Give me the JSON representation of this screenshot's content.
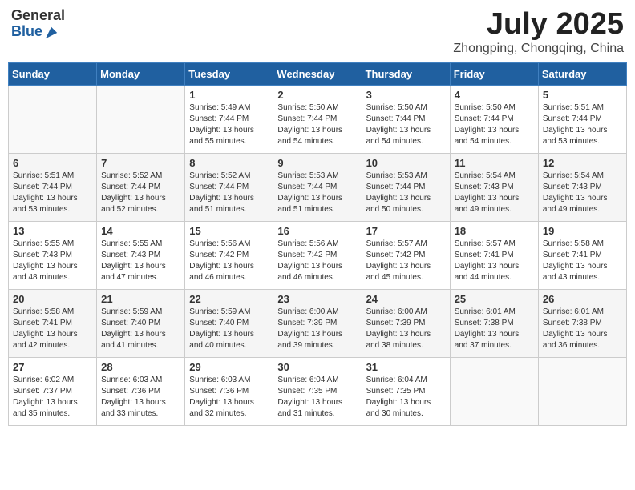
{
  "logo": {
    "general": "General",
    "blue": "Blue"
  },
  "title": {
    "month_year": "July 2025",
    "location": "Zhongping, Chongqing, China"
  },
  "weekdays": [
    "Sunday",
    "Monday",
    "Tuesday",
    "Wednesday",
    "Thursday",
    "Friday",
    "Saturday"
  ],
  "weeks": [
    [
      {
        "day": "",
        "info": ""
      },
      {
        "day": "",
        "info": ""
      },
      {
        "day": "1",
        "info": "Sunrise: 5:49 AM\nSunset: 7:44 PM\nDaylight: 13 hours and 55 minutes."
      },
      {
        "day": "2",
        "info": "Sunrise: 5:50 AM\nSunset: 7:44 PM\nDaylight: 13 hours and 54 minutes."
      },
      {
        "day": "3",
        "info": "Sunrise: 5:50 AM\nSunset: 7:44 PM\nDaylight: 13 hours and 54 minutes."
      },
      {
        "day": "4",
        "info": "Sunrise: 5:50 AM\nSunset: 7:44 PM\nDaylight: 13 hours and 54 minutes."
      },
      {
        "day": "5",
        "info": "Sunrise: 5:51 AM\nSunset: 7:44 PM\nDaylight: 13 hours and 53 minutes."
      }
    ],
    [
      {
        "day": "6",
        "info": "Sunrise: 5:51 AM\nSunset: 7:44 PM\nDaylight: 13 hours and 53 minutes."
      },
      {
        "day": "7",
        "info": "Sunrise: 5:52 AM\nSunset: 7:44 PM\nDaylight: 13 hours and 52 minutes."
      },
      {
        "day": "8",
        "info": "Sunrise: 5:52 AM\nSunset: 7:44 PM\nDaylight: 13 hours and 51 minutes."
      },
      {
        "day": "9",
        "info": "Sunrise: 5:53 AM\nSunset: 7:44 PM\nDaylight: 13 hours and 51 minutes."
      },
      {
        "day": "10",
        "info": "Sunrise: 5:53 AM\nSunset: 7:44 PM\nDaylight: 13 hours and 50 minutes."
      },
      {
        "day": "11",
        "info": "Sunrise: 5:54 AM\nSunset: 7:43 PM\nDaylight: 13 hours and 49 minutes."
      },
      {
        "day": "12",
        "info": "Sunrise: 5:54 AM\nSunset: 7:43 PM\nDaylight: 13 hours and 49 minutes."
      }
    ],
    [
      {
        "day": "13",
        "info": "Sunrise: 5:55 AM\nSunset: 7:43 PM\nDaylight: 13 hours and 48 minutes."
      },
      {
        "day": "14",
        "info": "Sunrise: 5:55 AM\nSunset: 7:43 PM\nDaylight: 13 hours and 47 minutes."
      },
      {
        "day": "15",
        "info": "Sunrise: 5:56 AM\nSunset: 7:42 PM\nDaylight: 13 hours and 46 minutes."
      },
      {
        "day": "16",
        "info": "Sunrise: 5:56 AM\nSunset: 7:42 PM\nDaylight: 13 hours and 46 minutes."
      },
      {
        "day": "17",
        "info": "Sunrise: 5:57 AM\nSunset: 7:42 PM\nDaylight: 13 hours and 45 minutes."
      },
      {
        "day": "18",
        "info": "Sunrise: 5:57 AM\nSunset: 7:41 PM\nDaylight: 13 hours and 44 minutes."
      },
      {
        "day": "19",
        "info": "Sunrise: 5:58 AM\nSunset: 7:41 PM\nDaylight: 13 hours and 43 minutes."
      }
    ],
    [
      {
        "day": "20",
        "info": "Sunrise: 5:58 AM\nSunset: 7:41 PM\nDaylight: 13 hours and 42 minutes."
      },
      {
        "day": "21",
        "info": "Sunrise: 5:59 AM\nSunset: 7:40 PM\nDaylight: 13 hours and 41 minutes."
      },
      {
        "day": "22",
        "info": "Sunrise: 5:59 AM\nSunset: 7:40 PM\nDaylight: 13 hours and 40 minutes."
      },
      {
        "day": "23",
        "info": "Sunrise: 6:00 AM\nSunset: 7:39 PM\nDaylight: 13 hours and 39 minutes."
      },
      {
        "day": "24",
        "info": "Sunrise: 6:00 AM\nSunset: 7:39 PM\nDaylight: 13 hours and 38 minutes."
      },
      {
        "day": "25",
        "info": "Sunrise: 6:01 AM\nSunset: 7:38 PM\nDaylight: 13 hours and 37 minutes."
      },
      {
        "day": "26",
        "info": "Sunrise: 6:01 AM\nSunset: 7:38 PM\nDaylight: 13 hours and 36 minutes."
      }
    ],
    [
      {
        "day": "27",
        "info": "Sunrise: 6:02 AM\nSunset: 7:37 PM\nDaylight: 13 hours and 35 minutes."
      },
      {
        "day": "28",
        "info": "Sunrise: 6:03 AM\nSunset: 7:36 PM\nDaylight: 13 hours and 33 minutes."
      },
      {
        "day": "29",
        "info": "Sunrise: 6:03 AM\nSunset: 7:36 PM\nDaylight: 13 hours and 32 minutes."
      },
      {
        "day": "30",
        "info": "Sunrise: 6:04 AM\nSunset: 7:35 PM\nDaylight: 13 hours and 31 minutes."
      },
      {
        "day": "31",
        "info": "Sunrise: 6:04 AM\nSunset: 7:35 PM\nDaylight: 13 hours and 30 minutes."
      },
      {
        "day": "",
        "info": ""
      },
      {
        "day": "",
        "info": ""
      }
    ]
  ]
}
